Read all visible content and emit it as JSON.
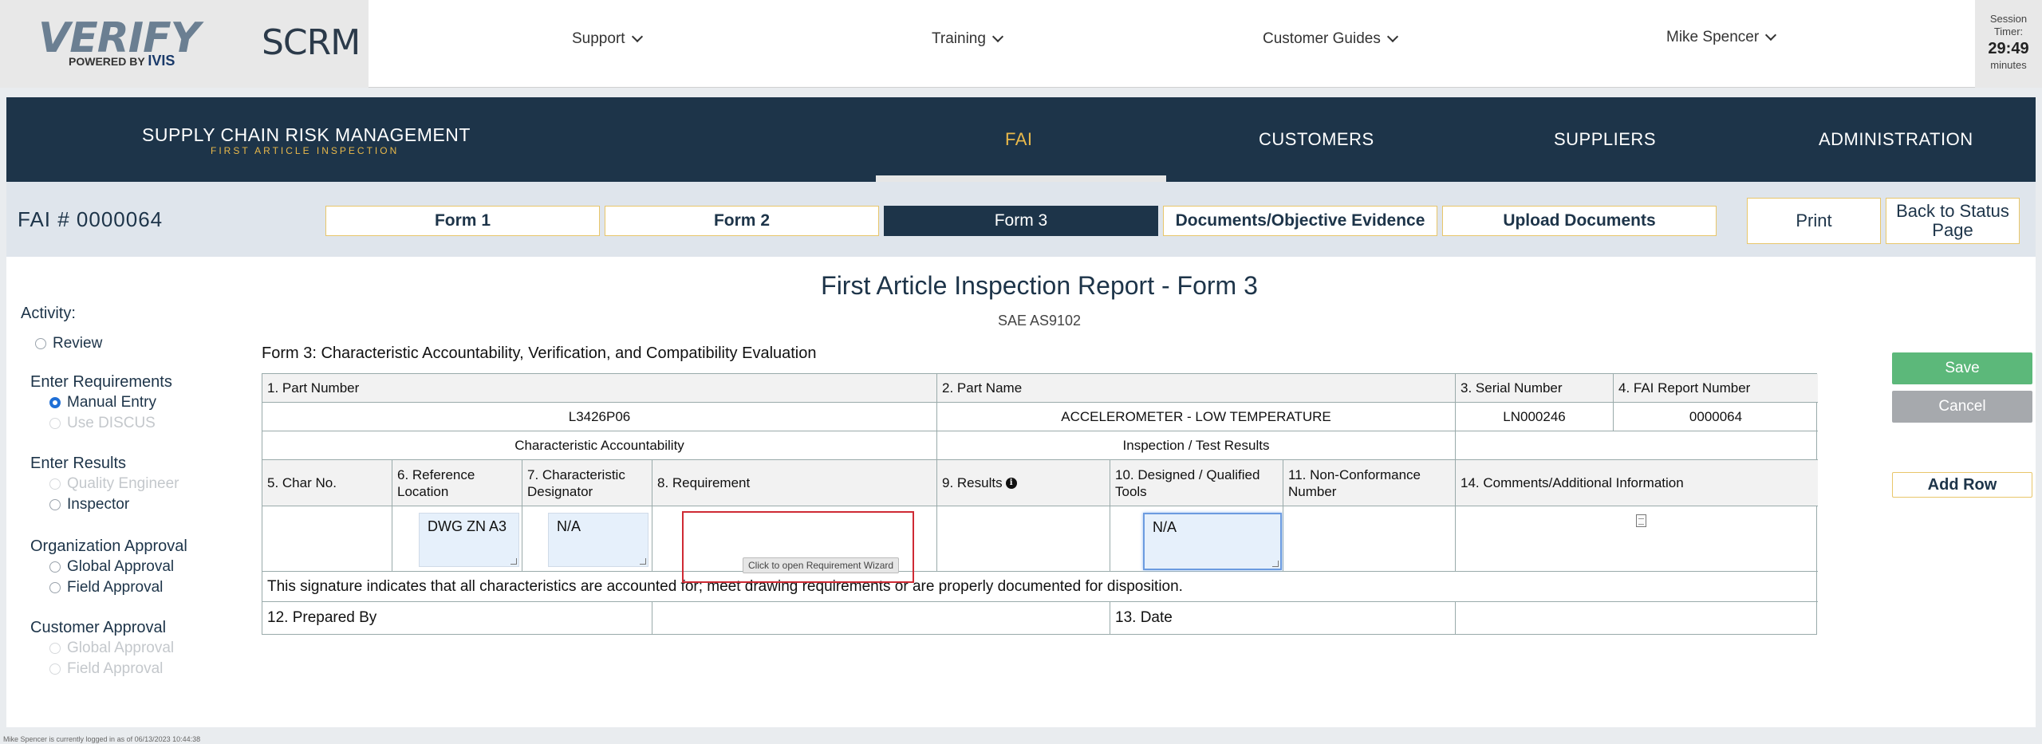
{
  "brand": {
    "logo_main": "VERIFY",
    "logo_powered": "POWERED BY",
    "logo_ivis": "IVIS",
    "app_short": "SCRM"
  },
  "topnav": [
    {
      "label": "Support"
    },
    {
      "label": "Training"
    },
    {
      "label": "Customer Guides"
    },
    {
      "label": "Mike Spencer"
    }
  ],
  "session": {
    "label_line1": "Session",
    "label_line2": "Timer:",
    "value": "29:49",
    "unit": "minutes"
  },
  "band": {
    "title": "SUPPLY CHAIN RISK MANAGEMENT",
    "subtitle": "FIRST ARTICLE INSPECTION",
    "nav": [
      {
        "label": "FAI",
        "active": true
      },
      {
        "label": "CUSTOMERS"
      },
      {
        "label": "SUPPLIERS"
      },
      {
        "label": "ADMINISTRATION"
      }
    ]
  },
  "subbar": {
    "fai_number": "FAI # 0000064",
    "tabs": [
      {
        "label": "Form 1"
      },
      {
        "label": "Form 2"
      },
      {
        "label": "Form 3",
        "active": true
      },
      {
        "label": "Documents/Objective Evidence"
      },
      {
        "label": "Upload Documents"
      }
    ],
    "print_label": "Print",
    "back_label_1": "Back to Status",
    "back_label_2": "Page"
  },
  "sidebar": {
    "activity_label": "Activity:",
    "review_label": "Review",
    "groups": [
      {
        "title": "Enter Requirements",
        "options": [
          "Manual Entry",
          "Use DISCUS"
        ]
      },
      {
        "title": "Enter Results",
        "options": [
          "Quality Engineer",
          "Inspector"
        ]
      },
      {
        "title": "Organization Approval",
        "options": [
          "Global Approval",
          "Field Approval"
        ]
      },
      {
        "title": "Customer Approval",
        "options": [
          "Global Approval",
          "Field Approval"
        ]
      }
    ]
  },
  "doc": {
    "title": "First Article Inspection Report - Form 3",
    "subtitle": "SAE AS9102",
    "description": "Form 3: Characteristic Accountability, Verification, and Compatibility Evaluation"
  },
  "table": {
    "h_part_number": "1. Part Number",
    "h_part_name": "2. Part Name",
    "h_serial": "3. Serial Number",
    "h_fai_report": "4. FAI Report Number",
    "part_number": "L3426P06",
    "part_name": "ACCELEROMETER - LOW TEMPERATURE",
    "serial": "LN000246",
    "fai_report": "0000064",
    "section_char": "Characteristic Accountability",
    "section_insp": "Inspection / Test Results",
    "col_char_no": "5. Char No.",
    "col_ref_loc": "6. Reference Location",
    "col_char_des": "7. Characteristic Designator",
    "col_req": "8. Requirement",
    "col_results": "9. Results",
    "col_tools": "10. Designed / Qualified Tools",
    "col_ncn": "11. Non-Conformance Number",
    "col_comments": "14. Comments/Additional Information",
    "row_ref_loc": "DWG ZN A3",
    "row_char_des": "N/A",
    "row_tools": "N/A",
    "req_tooltip": "Click to open Requirement Wizard",
    "signature_text": "This signature indicates that all characteristics are accounted for; meet drawing requirements or are properly documented for disposition.",
    "prepared_by": "12. Prepared By",
    "date": "13. Date"
  },
  "actions": {
    "save": "Save",
    "cancel": "Cancel",
    "add_row": "Add Row"
  },
  "footer": "Mike Spencer is currently logged in as of 06/13/2023 10:44:38",
  "colors": {
    "navy": "#1d3449",
    "gold": "#e8b84a",
    "save_green": "#5cb87a",
    "cancel_gray": "#a6a9ad",
    "highlight_red": "#cf2a34"
  }
}
